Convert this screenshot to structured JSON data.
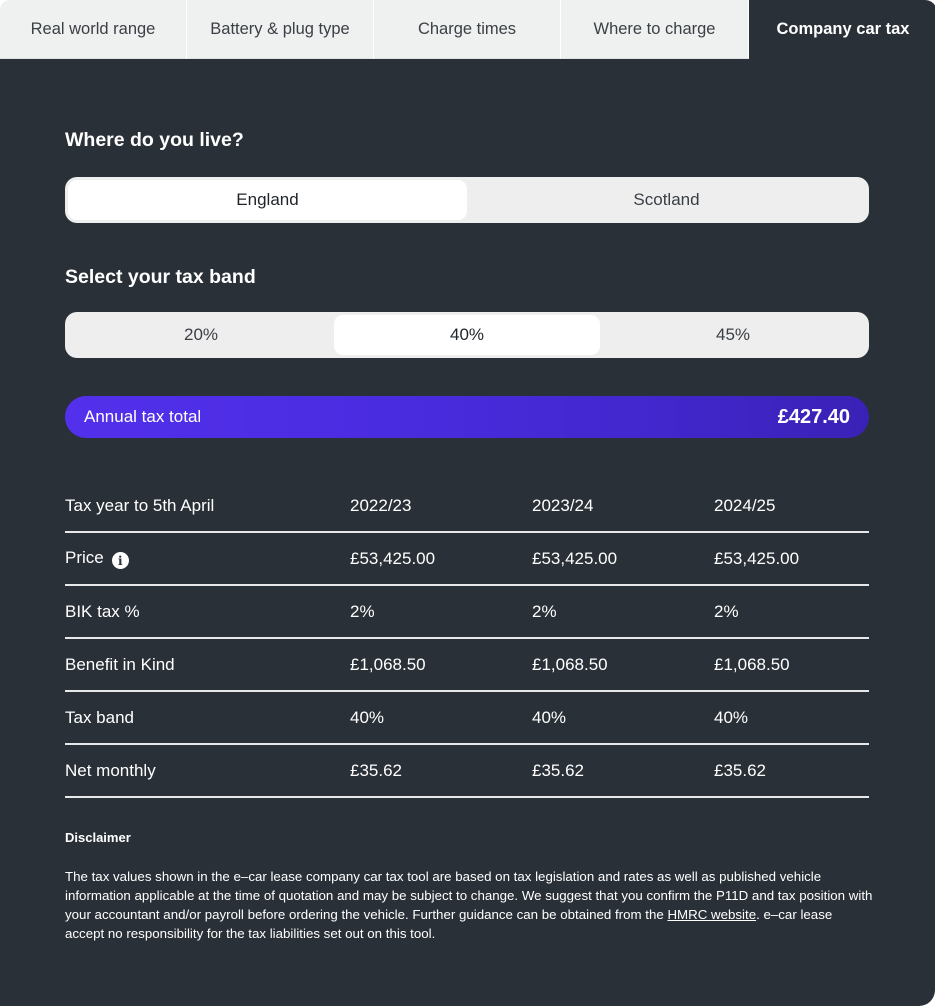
{
  "tabs": [
    {
      "label": "Real world range",
      "active": false
    },
    {
      "label": "Battery & plug type",
      "active": false
    },
    {
      "label": "Charge times",
      "active": false
    },
    {
      "label": "Where to charge",
      "active": false
    },
    {
      "label": "Company car tax",
      "active": true
    }
  ],
  "location": {
    "title": "Where do you live?",
    "options": [
      "England",
      "Scotland"
    ],
    "selected": "England"
  },
  "tax_band": {
    "title": "Select your tax band",
    "options": [
      "20%",
      "40%",
      "45%"
    ],
    "selected": "40%"
  },
  "annual_total": {
    "label": "Annual tax total",
    "value": "£427.40"
  },
  "table": {
    "header": [
      "Tax year to 5th April",
      "2022/23",
      "2023/24",
      "2024/25"
    ],
    "rows": [
      {
        "label": "Price",
        "info_icon": "info-icon",
        "values": [
          "£53,425.00",
          "£53,425.00",
          "£53,425.00"
        ]
      },
      {
        "label": "BIK tax %",
        "values": [
          "2%",
          "2%",
          "2%"
        ]
      },
      {
        "label": "Benefit in Kind",
        "values": [
          "£1,068.50",
          "£1,068.50",
          "£1,068.50"
        ]
      },
      {
        "label": "Tax band",
        "values": [
          "40%",
          "40%",
          "40%"
        ]
      },
      {
        "label": "Net monthly",
        "values": [
          "£35.62",
          "£35.62",
          "£35.62"
        ]
      }
    ]
  },
  "disclaimer": {
    "title": "Disclaimer",
    "text_before_link": "The tax values shown in the e–car lease company car tax tool are based on tax legislation and rates as well as published vehicle information applicable at the time of quotation and may be subject to change. We suggest that you confirm the P11D and tax position with your accountant and/or payroll before ordering the vehicle. Further guidance can be obtained from the ",
    "link_text": "HMRC website",
    "text_after_link": ". e–car lease accept no responsibility for the tax liabilities set out on this tool."
  },
  "colors": {
    "panel_bg": "#2a3037",
    "tab_bg": "#eff0f0",
    "accent_start": "#5330ec",
    "accent_end": "#3a21b6"
  }
}
